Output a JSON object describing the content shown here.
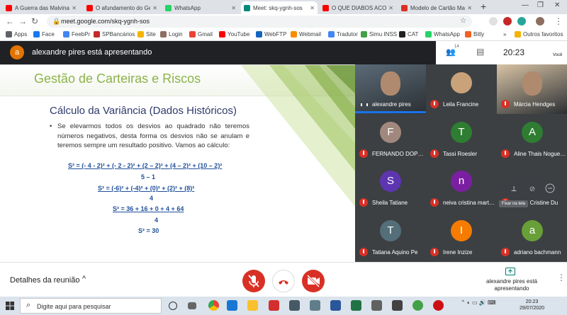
{
  "browser": {
    "tabs": [
      {
        "title": "A Guerra das Malvinas",
        "favicon_color": "#ff0000",
        "active": false
      },
      {
        "title": "O afundamento do Gen",
        "favicon_color": "#ff0000",
        "active": false
      },
      {
        "title": "WhatsApp",
        "favicon_color": "#25d366",
        "active": false
      },
      {
        "title": "Meet: skq-ygnh-sos",
        "favicon_color": "#00897b",
        "active": true
      },
      {
        "title": "O QUE DIABOS ACONT",
        "favicon_color": "#ff0000",
        "active": false
      },
      {
        "title": "Modelo de Cartão Mais",
        "favicon_color": "#d93025",
        "active": false
      }
    ],
    "new_tab": "+",
    "url": "meet.google.com/skq-ygnh-sos",
    "bookmarks": [
      {
        "label": "Apps",
        "icon": "apps-grid-icon",
        "color": "#5f6368"
      },
      {
        "label": "Face",
        "icon": "facebook-icon",
        "color": "#1877f2"
      },
      {
        "label": "FeebPr",
        "icon": "feed-icon",
        "color": "#4285f4"
      },
      {
        "label": "SPBancários",
        "icon": "bank-icon",
        "color": "#c62828"
      },
      {
        "label": "Site",
        "icon": "site-icon",
        "color": "#f4b400"
      },
      {
        "label": "Login",
        "icon": "login-icon",
        "color": "#8d6e63"
      },
      {
        "label": "Gmail",
        "icon": "gmail-icon",
        "color": "#ea4335"
      },
      {
        "label": "YouTube",
        "icon": "youtube-icon",
        "color": "#ff0000"
      },
      {
        "label": "WebFTP",
        "icon": "webftp-icon",
        "color": "#1565c0"
      },
      {
        "label": "Webmail",
        "icon": "webmail-icon",
        "color": "#fb8c00"
      },
      {
        "label": "Tradutor",
        "icon": "translate-icon",
        "color": "#4285f4"
      },
      {
        "label": "Simu INSS",
        "icon": "simulator-icon",
        "color": "#43a047"
      },
      {
        "label": "CAT",
        "icon": "cat-icon",
        "color": "#212121"
      },
      {
        "label": "WhatsApp",
        "icon": "whatsapp-icon",
        "color": "#25d366"
      },
      {
        "label": "Bitly",
        "icon": "bitly-icon",
        "color": "#ee6123"
      }
    ],
    "bookmarks_more": "»",
    "other_favorites": "Outros favoritos"
  },
  "meet": {
    "presenter_initial": "a",
    "presenter_text": "alexandre pires está apresentando",
    "participant_count": "14",
    "clock": "20:23",
    "self_label": "Você",
    "participants": [
      {
        "name": "alexandre pires",
        "initial": "",
        "color": "#5b6b78",
        "muted": false,
        "video": true
      },
      {
        "name": "Leila Francine",
        "initial": "",
        "color": "#c9a27a",
        "muted": true,
        "video": false
      },
      {
        "name": "Márcia Hendges",
        "initial": "",
        "color": "#d8c3a5",
        "muted": true,
        "video": true
      },
      {
        "name": "FERNANDO DOPKE",
        "initial": "F",
        "color": "#a1887f",
        "muted": true,
        "video": false
      },
      {
        "name": "Tassi Roesler",
        "initial": "T",
        "color": "#2e7d32",
        "muted": true,
        "video": false
      },
      {
        "name": "Aline Thais Nogueira",
        "initial": "A",
        "color": "#2e7d32",
        "muted": true,
        "video": false
      },
      {
        "name": "Sheila Tatiane",
        "initial": "S",
        "color": "#5e35b1",
        "muted": true,
        "video": false
      },
      {
        "name": "neiva cristina martins",
        "initial": "n",
        "color": "#7b1fa2",
        "muted": true,
        "video": false
      },
      {
        "name": "Crisle Cristine Du",
        "initial": "",
        "color": "#3c4043",
        "muted": true,
        "video": false
      },
      {
        "name": "Tatiana Aquino Pe",
        "initial": "T",
        "color": "#546e7a",
        "muted": true,
        "video": false
      },
      {
        "name": "Irene Inzize",
        "initial": "I",
        "color": "#f57c00",
        "muted": true,
        "video": false
      },
      {
        "name": "adriano bachmann",
        "initial": "a",
        "color": "#689f38",
        "muted": true,
        "video": false
      }
    ],
    "pin_tooltip": "Fixar na tela",
    "details_label": "Detalhes da reunião",
    "presenting_label": "alexandre pires está apresentando"
  },
  "slide": {
    "title": "Gestão de Carteiras e Riscos",
    "subtitle": "Cálculo da Variância (Dados Históricos)",
    "bullet": "Se elevarmos todos os desvios ao quadrado não teremos números negativos, desta forma os desvios não se anulam e teremos sempre um resultado positivo. Vamos ao cálculo:",
    "eq1_num": "S² = (- 4 - 2)² + (- 2 - 2)² + (2 – 2)² + (4 – 2)² + (10 – 2)²",
    "eq1_den": "5 – 1",
    "eq2_num": "S² = (-6)² + (-4)² + (0)² + (2)² + (8)²",
    "eq2_den": "4",
    "eq3_num": "S² = 36 + 16 + 0 + 4 + 64",
    "eq3_den": "4",
    "eq4": "S² = 30",
    "title_color": "#8cb34a",
    "subtitle_color": "#2d3a6b",
    "equation_color": "#1f4f9a"
  },
  "taskbar": {
    "search_placeholder": "Digite aqui para pesquisar",
    "time": "20:23",
    "date": "29/07/2020"
  }
}
